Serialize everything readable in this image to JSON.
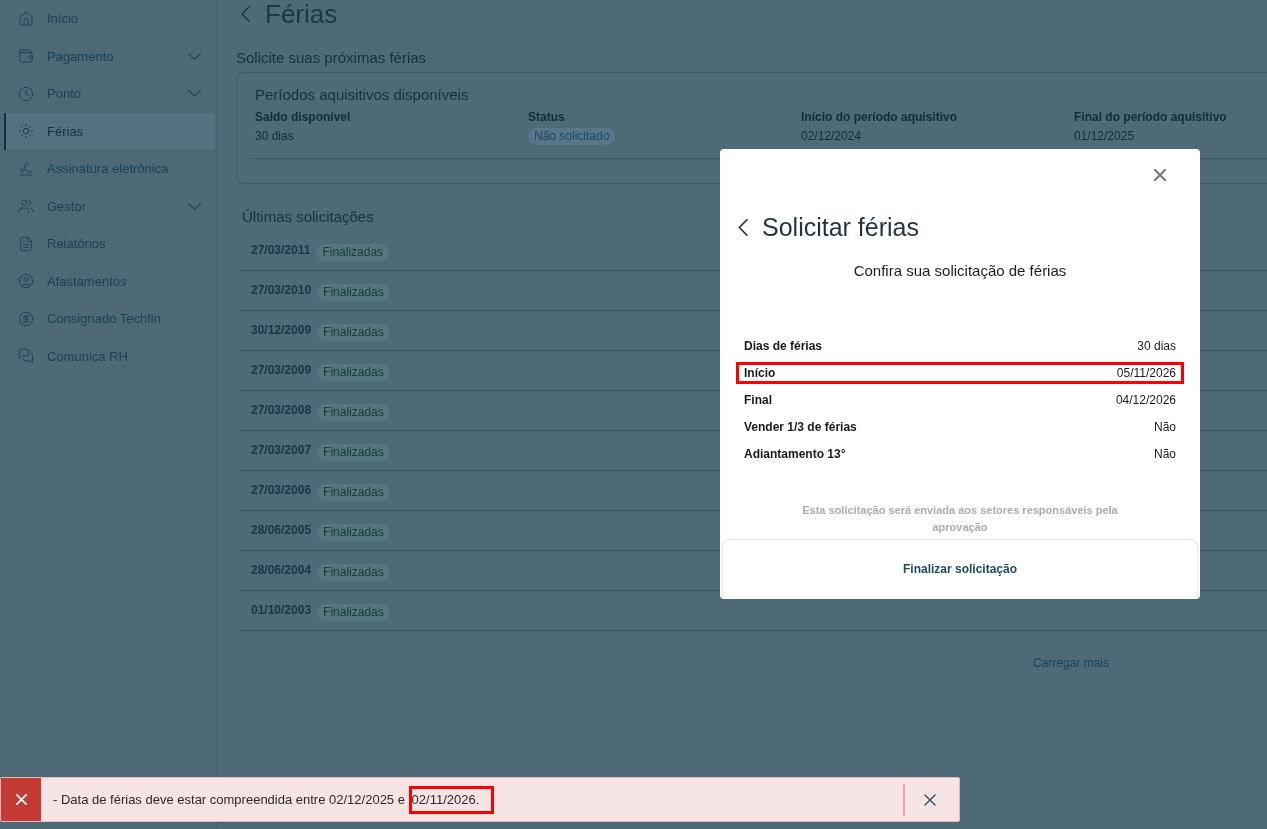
{
  "sidebar": {
    "items": [
      {
        "label": "Início",
        "selected": false,
        "expandable": false
      },
      {
        "label": "Pagamento",
        "selected": false,
        "expandable": true
      },
      {
        "label": "Ponto",
        "selected": false,
        "expandable": true
      },
      {
        "label": "Férias",
        "selected": true,
        "expandable": false
      },
      {
        "label": "Assinatura eletrônica",
        "selected": false,
        "expandable": false
      },
      {
        "label": "Gestor",
        "selected": false,
        "expandable": true
      },
      {
        "label": "Relatórios",
        "selected": false,
        "expandable": false
      },
      {
        "label": "Afastamentos",
        "selected": false,
        "expandable": false
      },
      {
        "label": "Consignado Techfin",
        "selected": false,
        "expandable": false
      },
      {
        "label": "Comunica RH",
        "selected": false,
        "expandable": false
      }
    ]
  },
  "page": {
    "title": "Férias",
    "subtitle": "Solicite suas próximas férias"
  },
  "periods_card": {
    "title": "Períodos aquisitivos disponíveis",
    "fields": [
      {
        "label": "Saldo disponível",
        "value": "30 dias",
        "kind": "text"
      },
      {
        "label": "Status",
        "value": "Não solicitado",
        "kind": "badge"
      },
      {
        "label": "Início do período aquisitivo",
        "value": "02/12/2024",
        "kind": "text"
      },
      {
        "label": "Final do período aquisitivo",
        "value": "01/12/2025",
        "kind": "text"
      }
    ]
  },
  "requests": {
    "title": "Últimas solicitações",
    "rows": [
      {
        "date": "27/03/2011",
        "status": "Finalizadas"
      },
      {
        "date": "27/03/2010",
        "status": "Finalizadas"
      },
      {
        "date": "30/12/2009",
        "status": "Finalizadas"
      },
      {
        "date": "27/03/2009",
        "status": "Finalizadas"
      },
      {
        "date": "27/03/2008",
        "status": "Finalizadas"
      },
      {
        "date": "27/03/2007",
        "status": "Finalizadas"
      },
      {
        "date": "27/03/2006",
        "status": "Finalizadas"
      },
      {
        "date": "28/06/2005",
        "status": "Finalizadas"
      },
      {
        "date": "28/06/2004",
        "status": "Finalizadas"
      },
      {
        "date": "01/10/2003",
        "status": "Finalizadas"
      }
    ],
    "load_more": "Carregar mais"
  },
  "modal": {
    "title": "Solicitar férias",
    "subtitle": "Confira sua solicitação de férias",
    "rows": [
      {
        "label": "Dias de férias",
        "value": "30 dias",
        "highlighted": false
      },
      {
        "label": "Início",
        "value": "05/11/2026",
        "highlighted": true
      },
      {
        "label": "Final",
        "value": "04/12/2026",
        "highlighted": false
      },
      {
        "label": "Vender 1/3 de férias",
        "value": "Não",
        "highlighted": false
      },
      {
        "label": "Adiantamento 13°",
        "value": "Não",
        "highlighted": false
      }
    ],
    "note": "Esta solicitação será enviada aos setores responsáveis pela aprovação",
    "action": "Finalizar solicitação"
  },
  "toast": {
    "kind": "error",
    "message": [
      {
        "text": "- Data de férias deve estar compreendida entre 02/12/2025 e ",
        "highlighted": false
      },
      {
        "text": "02/11/2026.",
        "highlighted": true
      }
    ]
  }
}
